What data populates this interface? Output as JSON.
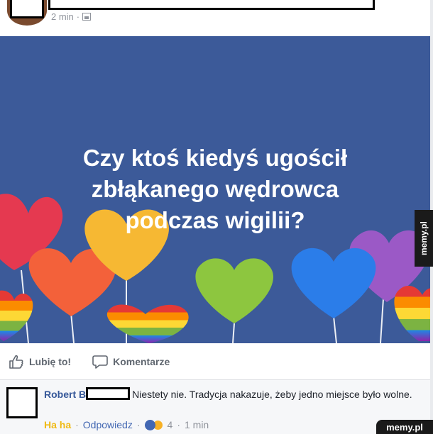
{
  "post": {
    "timestamp": "2 min",
    "separator": "·",
    "audience_icon": "group-icon",
    "banner_lines": [
      "Czy ktoś kiedyś ugościł",
      "zbłąkanego wędrowca",
      "podczas wigilii?"
    ],
    "banner_color": "#3c5a99"
  },
  "actions": {
    "like_label": "Lubię to!",
    "comment_label": "Komentarze"
  },
  "comment": {
    "author_first": "Robert B",
    "text": "Niestety nie. Tradycja nakazuje, żeby jedno miejsce było wolne.",
    "haha_label": "Ha ha",
    "reply_label": "Odpowiedz",
    "separator": "·",
    "reaction_count": "4",
    "time": "1 min"
  },
  "watermark": {
    "side": "memy.pl",
    "corner": "memy.pl"
  }
}
